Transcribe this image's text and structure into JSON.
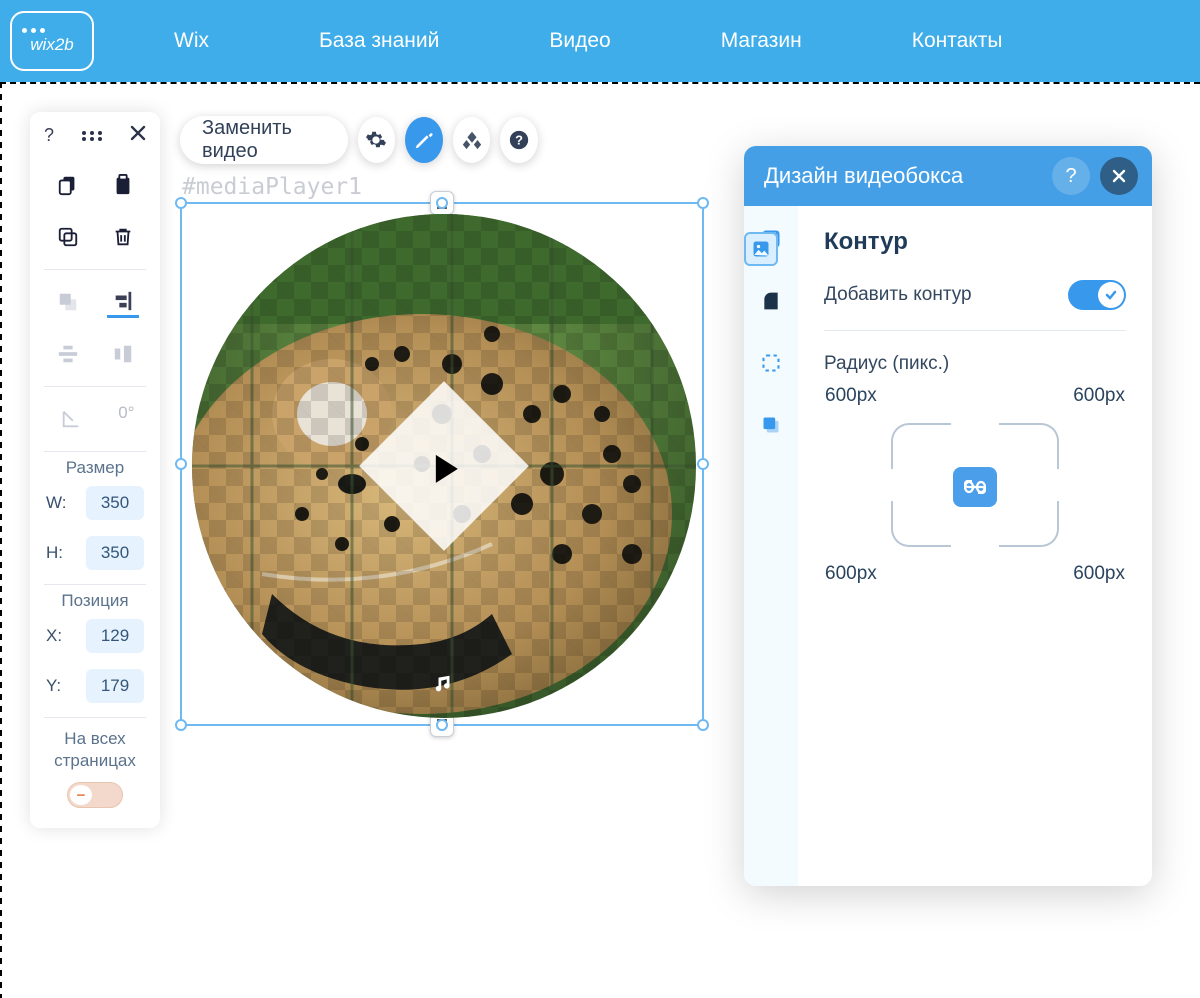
{
  "nav": {
    "logo": "wix2b",
    "items": [
      "Wix",
      "База знаний",
      "Видео",
      "Магазин",
      "Контакты"
    ]
  },
  "toolbox": {
    "help": "?",
    "rotation_value": "0°",
    "size_title": "Размер",
    "w_label": "W:",
    "w_value": "350",
    "h_label": "H:",
    "h_value": "350",
    "pos_title": "Позиция",
    "x_label": "X:",
    "x_value": "129",
    "y_label": "Y:",
    "y_value": "179",
    "all_pages": "На всех страницах"
  },
  "actionbar": {
    "replace": "Заменить видео"
  },
  "stage": {
    "hash": "#mediaPlayer1"
  },
  "panel": {
    "title": "Дизайн видеобокса",
    "section_title": "Контур",
    "add_outline": "Добавить контур",
    "radius_title": "Радиус (пикс.)",
    "tl": "600px",
    "tr": "600px",
    "bl": "600px",
    "br": "600px"
  }
}
